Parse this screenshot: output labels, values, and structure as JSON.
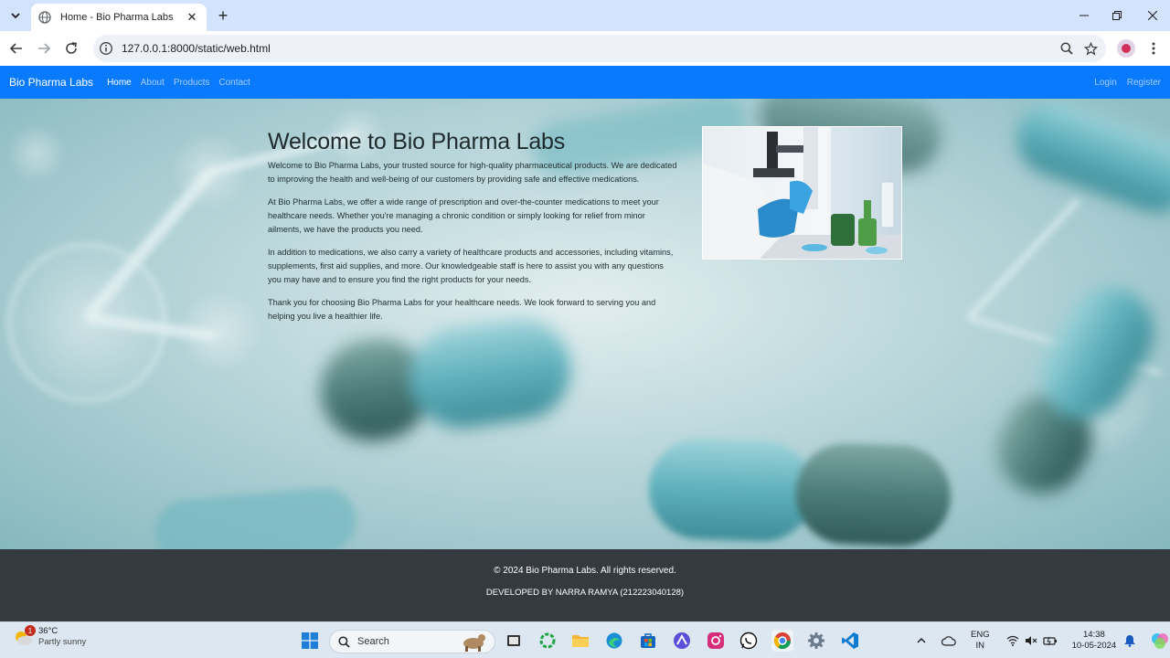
{
  "browser": {
    "tab_title": "Home - Bio Pharma Labs",
    "url": "127.0.0.1:8000/static/web.html"
  },
  "navbar": {
    "brand": "Bio Pharma Labs",
    "links": [
      "Home",
      "About",
      "Products",
      "Contact"
    ],
    "active": "Home",
    "right_links": [
      "Login",
      "Register"
    ],
    "color": "#0a7afd"
  },
  "main": {
    "heading": "Welcome to Bio Pharma Labs",
    "paragraphs": [
      "Welcome to Bio Pharma Labs, your trusted source for high-quality pharmaceutical products. We are dedicated to improving the health and well-being of our customers by providing safe and effective medications.",
      "At Bio Pharma Labs, we offer a wide range of prescription and over-the-counter medications to meet your healthcare needs. Whether you're managing a chronic condition or simply looking for relief from minor ailments, we have the products you need.",
      "In addition to medications, we also carry a variety of healthcare products and accessories, including vitamins, supplements, first aid supplies, and more. Our knowledgeable staff is here to assist you with any questions you may have and to ensure you find the right products for your needs.",
      "Thank you for choosing Bio Pharma Labs for your healthcare needs. We look forward to serving you and helping you live a healthier life."
    ]
  },
  "footer": {
    "copyright": "© 2024 Bio Pharma Labs. All rights reserved.",
    "developer": "DEVELOPED BY NARRA RAMYA (212223040128)",
    "color": "#343a40"
  },
  "taskbar": {
    "weather_temp": "36°C",
    "weather_desc": "Partly sunny",
    "weather_badge": "1",
    "search_label": "Search",
    "lang_line1": "ENG",
    "lang_line2": "IN",
    "time": "14:38",
    "date": "10-05-2024"
  }
}
